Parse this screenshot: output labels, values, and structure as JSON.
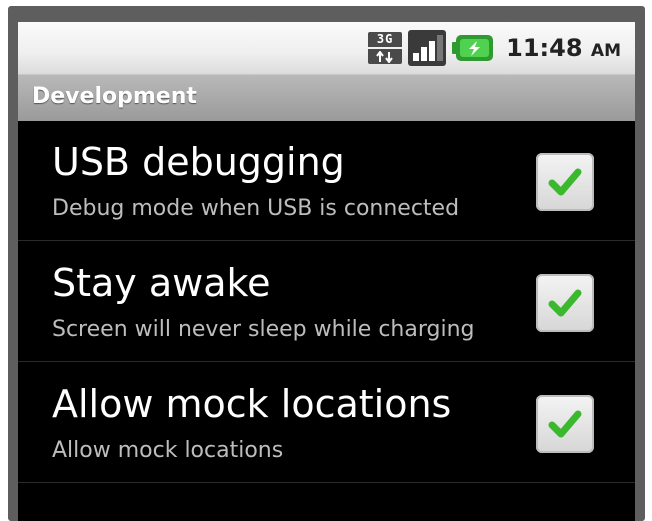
{
  "status_bar": {
    "network_icon_text": "3G",
    "time": "11:48",
    "ampm": "AM",
    "icons": [
      "network-3g-icon",
      "signal-strength-icon",
      "battery-charging-icon"
    ]
  },
  "header": {
    "title": "Development"
  },
  "settings": [
    {
      "label": "USB debugging",
      "summary": "Debug mode when USB is connected",
      "checked": true
    },
    {
      "label": "Stay awake",
      "summary": "Screen will never sleep while charging",
      "checked": true
    },
    {
      "label": "Allow mock locations",
      "summary": "Allow mock locations",
      "checked": true
    }
  ],
  "colors": {
    "check": "#3cb82e",
    "background": "#000000",
    "title_bar": "#a8a8a8"
  }
}
